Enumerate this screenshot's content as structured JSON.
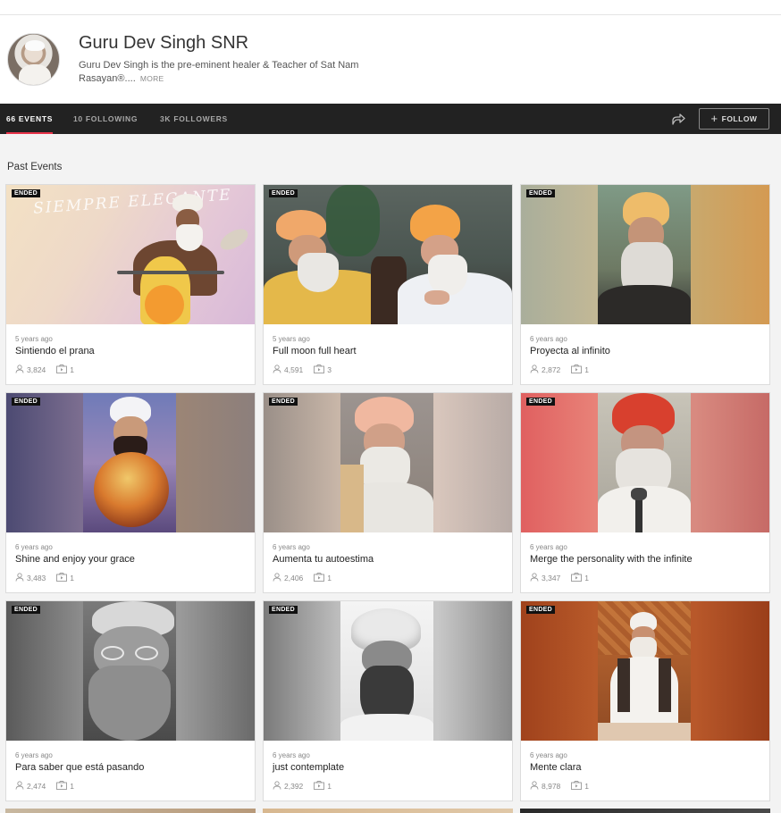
{
  "profile": {
    "name": "Guru Dev Singh SNR",
    "bio": "Guru Dev Singh is the pre-eminent healer & Teacher of Sat Nam Rasayan®....",
    "more_label": "MORE"
  },
  "tabs": [
    {
      "label": "66 EVENTS",
      "active": true
    },
    {
      "label": "10 FOLLOWING",
      "active": false
    },
    {
      "label": "3K FOLLOWERS",
      "active": false
    }
  ],
  "follow_label": "FOLLOW",
  "section_title": "Past Events",
  "events": [
    {
      "badge": "ENDED",
      "ago": "5 years ago",
      "title": "Sintiendo el prana",
      "attendees": "3,824",
      "sessions": "1",
      "overlay_text": "SIEMPRE ELEGANTE"
    },
    {
      "badge": "ENDED",
      "ago": "5 years ago",
      "title": "Full moon full heart",
      "attendees": "4,591",
      "sessions": "3"
    },
    {
      "badge": "ENDED",
      "ago": "6 years ago",
      "title": "Proyecta al infinito",
      "attendees": "2,872",
      "sessions": "1"
    },
    {
      "badge": "ENDED",
      "ago": "6 years ago",
      "title": "Shine and enjoy your grace",
      "attendees": "3,483",
      "sessions": "1"
    },
    {
      "badge": "ENDED",
      "ago": "6 years ago",
      "title": "Aumenta tu autoestima",
      "attendees": "2,406",
      "sessions": "1"
    },
    {
      "badge": "ENDED",
      "ago": "6 years ago",
      "title": "Merge the personality with the infinite",
      "attendees": "3,347",
      "sessions": "1"
    },
    {
      "badge": "ENDED",
      "ago": "6 years ago",
      "title": "Para saber que está pasando",
      "attendees": "2,474",
      "sessions": "1"
    },
    {
      "badge": "ENDED",
      "ago": "6 years ago",
      "title": "just contemplate",
      "attendees": "2,392",
      "sessions": "1"
    },
    {
      "badge": "ENDED",
      "ago": "6 years ago",
      "title": "Mente clara",
      "attendees": "8,978",
      "sessions": "1"
    }
  ],
  "icons": {
    "share": "share-icon",
    "attendees": "person-icon",
    "sessions": "video-icon",
    "follow": "plus-icon"
  },
  "colors": {
    "navbar": "#222222",
    "active_tab_underline": "#e8334a",
    "badge": "#111111"
  }
}
